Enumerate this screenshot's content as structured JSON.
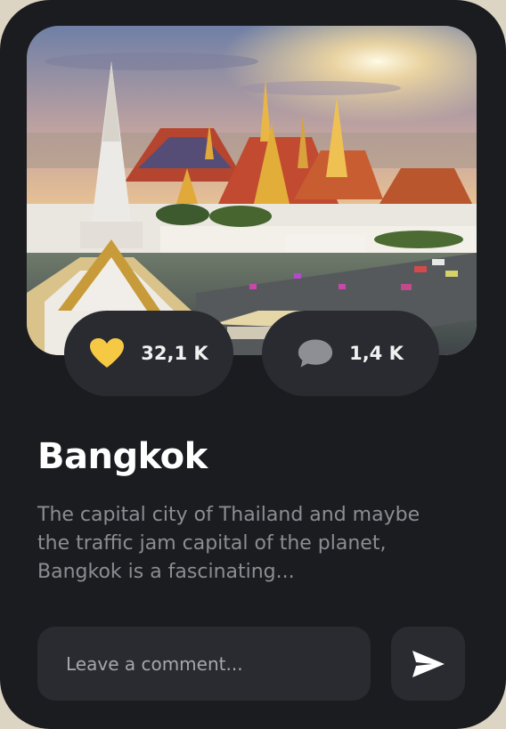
{
  "card": {
    "title": "Bangkok",
    "description": "The capital city of Thailand and maybe the traffic jam capital of the planet, Bangkok is a fascinating...",
    "likes": "32,1 K",
    "comments": "1,4 K"
  },
  "comment_box": {
    "placeholder": "Leave a comment..."
  },
  "icons": {
    "like": "heart-icon",
    "comment": "speech-bubble-icon",
    "send": "paper-plane-icon"
  },
  "colors": {
    "card_background": "#1b1c20",
    "pill_background": "#2a2b30",
    "heart": "#f6c945",
    "comment_bubble": "#8e8f94",
    "title": "#ffffff",
    "description": "#8c8d92"
  }
}
